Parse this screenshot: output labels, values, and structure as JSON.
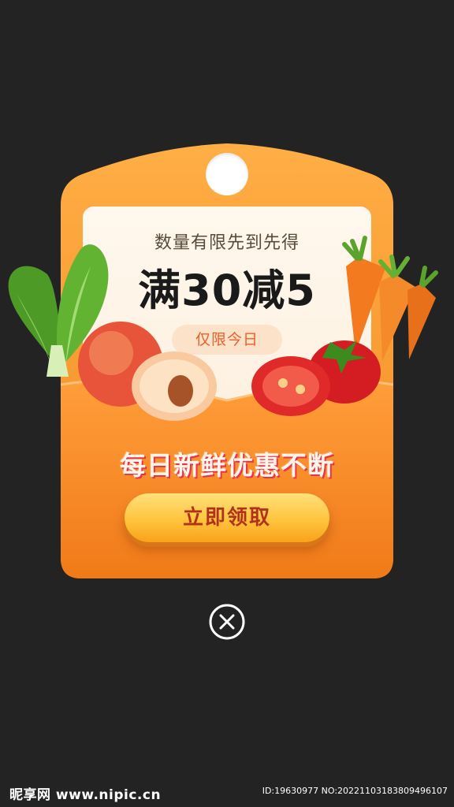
{
  "coupon": {
    "subtitle": "数量有限先到先得",
    "headline": "满30减5",
    "tag": "仅限今日",
    "slogan": "每日新鲜优惠不断",
    "claim_label": "立即领取"
  },
  "produce_icons": [
    "bok-choy-icon",
    "peach-icon",
    "carrot-icon",
    "tomato-icon"
  ],
  "close_icon": "close-icon",
  "watermark": {
    "left": "昵享网 www.nipic.cn",
    "right": "ID:19630977 NO:20221103183809496107"
  },
  "colors": {
    "background": "#232323",
    "coupon_orange": "#f5821f",
    "coupon_light": "#ffa13a",
    "button_yellow": "#ffc43d",
    "button_text": "#b2311a",
    "tag_text": "#e8612a"
  }
}
